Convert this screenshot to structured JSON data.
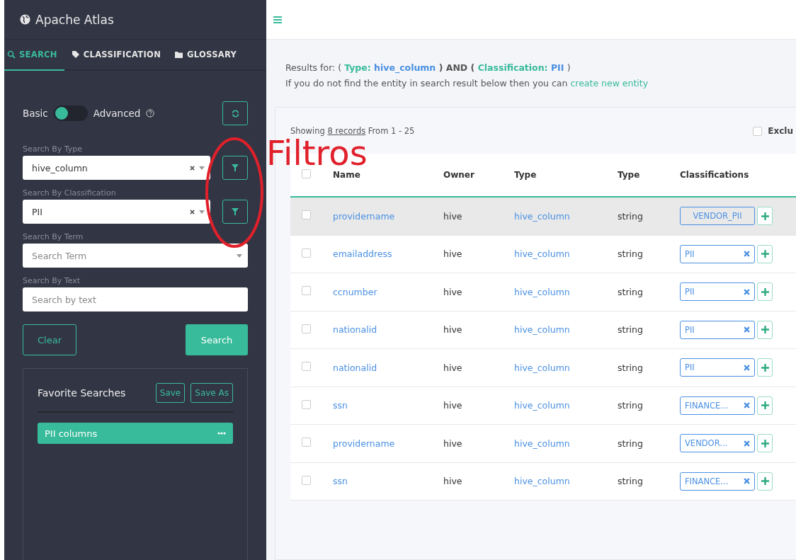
{
  "app": {
    "title": "Apache Atlas"
  },
  "tabs": [
    {
      "label": "SEARCH",
      "selected": true
    },
    {
      "label": "CLASSIFICATION",
      "selected": false
    },
    {
      "label": "GLOSSARY",
      "selected": false
    }
  ],
  "mode_toggle": {
    "left_label": "Basic",
    "right_label": "Advanced",
    "on": false
  },
  "filters": [
    {
      "label": "Search By Type",
      "kind": "filtered_select",
      "value": "hive_column"
    },
    {
      "label": "Search By Classification",
      "kind": "filtered_select",
      "value": "PII"
    },
    {
      "label": "Search By Term",
      "kind": "select",
      "placeholder": "Search Term"
    },
    {
      "label": "Search By Text",
      "kind": "text",
      "placeholder": "Search by text"
    }
  ],
  "actions": {
    "clear": "Clear",
    "search": "Search"
  },
  "favorites": {
    "title": "Favorite Searches",
    "save": "Save",
    "save_as": "Save As",
    "items": [
      {
        "label": "PII columns",
        "selected": true
      }
    ]
  },
  "annotation": {
    "text": "Filtros"
  },
  "results": {
    "query": [
      {
        "kind": "plain",
        "text": "Results for: ("
      },
      {
        "kind": "key",
        "text": "Type:"
      },
      {
        "kind": "value",
        "text": "hive_column"
      },
      {
        "kind": "op",
        "text": ") AND ("
      },
      {
        "kind": "key",
        "text": "Classification:"
      },
      {
        "kind": "value",
        "text": "PII"
      },
      {
        "kind": "plain",
        "text": ")"
      }
    ],
    "hint": "If you do not find the entity in search result below then you can",
    "hint_link": "create new entity",
    "showing": "Showing",
    "records_link": "8 records",
    "range": "From 1 - 25",
    "exclude": {
      "label": "Exclu",
      "checked": false
    }
  },
  "table": {
    "columns": [
      "Name",
      "Owner",
      "Type",
      "Type",
      "Classifications"
    ],
    "all_checked": false,
    "rows": [
      {
        "name": "providername",
        "owner": "hive",
        "type": "hive_column",
        "datatype": "string",
        "tag": "VENDOR_PII",
        "removable": false,
        "highlighted": true,
        "checked": false
      },
      {
        "name": "emailaddress",
        "owner": "hive",
        "type": "hive_column",
        "datatype": "string",
        "tag": "PII",
        "removable": true,
        "highlighted": false,
        "checked": false
      },
      {
        "name": "ccnumber",
        "owner": "hive",
        "type": "hive_column",
        "datatype": "string",
        "tag": "PII",
        "removable": true,
        "highlighted": false,
        "checked": false
      },
      {
        "name": "nationalid",
        "owner": "hive",
        "type": "hive_column",
        "datatype": "string",
        "tag": "PII",
        "removable": true,
        "highlighted": false,
        "checked": false
      },
      {
        "name": "nationalid",
        "owner": "hive",
        "type": "hive_column",
        "datatype": "string",
        "tag": "PII",
        "removable": true,
        "highlighted": false,
        "checked": false
      },
      {
        "name": "ssn",
        "owner": "hive",
        "type": "hive_column",
        "datatype": "string",
        "tag": "FINANCE...",
        "removable": true,
        "highlighted": false,
        "checked": false
      },
      {
        "name": "providername",
        "owner": "hive",
        "type": "hive_column",
        "datatype": "string",
        "tag": "VENDOR...",
        "removable": true,
        "highlighted": false,
        "checked": false
      },
      {
        "name": "ssn",
        "owner": "hive",
        "type": "hive_column",
        "datatype": "string",
        "tag": "FINANCE...",
        "removable": true,
        "highlighted": false,
        "checked": false
      }
    ]
  }
}
